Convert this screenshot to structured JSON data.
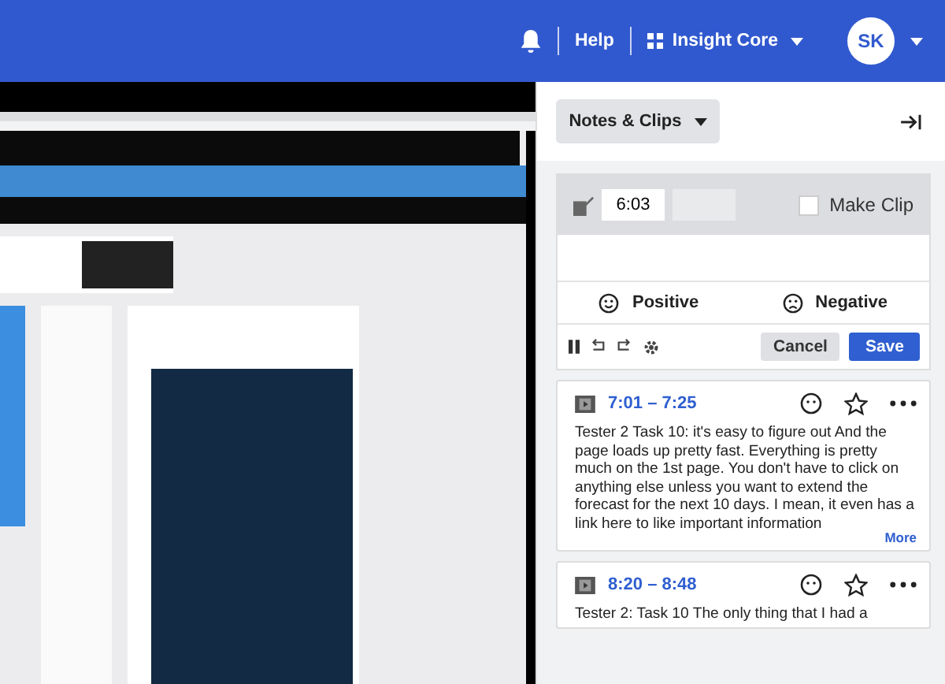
{
  "header": {
    "help": "Help",
    "product": "Insight Core",
    "avatar": "SK"
  },
  "panel": {
    "dropdown": "Notes & Clips"
  },
  "editor": {
    "time": "6:03",
    "make_clip": {
      "label": "Make Clip",
      "checked": false
    },
    "sentiments": [
      {
        "label": "Positive",
        "kind": "positive"
      },
      {
        "label": "Negative",
        "kind": "negative"
      }
    ],
    "cancel": "Cancel",
    "save": "Save"
  },
  "clips": [
    {
      "range": "7:01 – 7:25",
      "text": "Tester 2 Task 10: it's easy to figure out And the page loads up pretty fast. Everything is pretty much on the 1st page. You don't have to click on anything else unless you want to extend the forecast for the next 10 days. I mean, it even has a link here to like important information",
      "more": "More"
    },
    {
      "range": "8:20 – 8:48",
      "text": "Tester 2: Task 10 The only thing that I had a"
    }
  ]
}
